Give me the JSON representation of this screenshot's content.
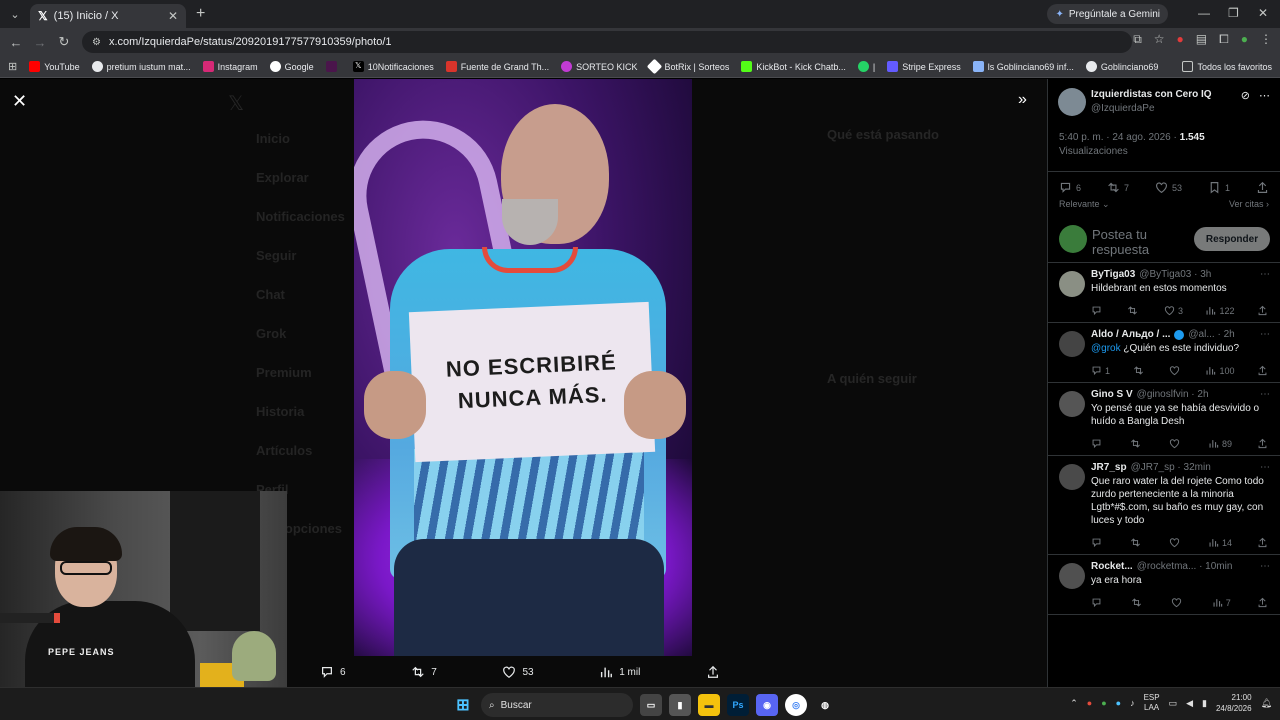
{
  "browser": {
    "tab_title": "(15) Inicio / X",
    "gemini_label": "Pregúntale a Gemini",
    "url": "x.com/IzquierdaPe/status/2092019177577910359/photo/1",
    "bookmarks": [
      "YouTube",
      "pretium iustum mat...",
      "Instagram",
      "Google",
      "10Notificaciones",
      "Fuente de Grand Th...",
      "SORTEO KICK",
      "BotRix | Sorteos",
      "KickBot - Kick Chatb...",
      "|",
      "Stripe Express",
      "ls Goblinciano69 inf...",
      "Goblinciano69"
    ],
    "bookmarks_all": "Todos los favoritos"
  },
  "background_nav": [
    "Inicio",
    "Explorar",
    "Notificaciones",
    "Seguir",
    "Chat",
    "Grok",
    "Premium",
    "Historia",
    "Artículos",
    "Perfil",
    "Más opciones"
  ],
  "background_right": {
    "trending": "Qué está pasando",
    "who_to_follow": "A quién seguir"
  },
  "photo": {
    "sign_text": "NO ESCRIBIRÉ NUNCA MÁS.",
    "actions": {
      "replies": "6",
      "reposts": "7",
      "likes": "53",
      "views": "1 mil"
    }
  },
  "webcam": {
    "hoodie_text": "PEPE JEANS"
  },
  "sidebar": {
    "author_name": "Izquierdistas con Cero IQ",
    "author_handle": "@IzquierdaPe",
    "post_time": "5:40 p. m. · 24 ago. 2026 ·",
    "views_count": "1.545",
    "views_label": "Visualizaciones",
    "stats": {
      "replies": "6",
      "reposts": "7",
      "likes": "53",
      "bookmarks": "1"
    },
    "sort_label": "Relevante",
    "quotes_label": "Ver citas",
    "reply_placeholder": "Postea tu respuesta",
    "reply_button": "Responder",
    "replies": [
      {
        "name": "ByTiga03",
        "handle": "@ByTiga03 · 3h",
        "text": "Hildebrant en estos momentos",
        "mention": "",
        "reply_count": "",
        "repost_count": "",
        "like_count": "3",
        "view_count": "122"
      },
      {
        "name": "Aldo / Альдо / ...",
        "handle": "@al... · 2h",
        "text": "¿Quién es este individuo?",
        "mention": "@grok",
        "reply_count": "1",
        "repost_count": "",
        "like_count": "",
        "view_count": "100"
      },
      {
        "name": "Gino S V",
        "handle": "@ginoslfvin · 2h",
        "text": "Yo pensé que ya se había desvivido o huído a Bangla Desh",
        "mention": "",
        "reply_count": "",
        "repost_count": "",
        "like_count": "",
        "view_count": "89"
      },
      {
        "name": "JR7_sp",
        "handle": "@JR7_sp · 32min",
        "text": "Que raro water la del rojete Como todo zurdo perteneciente a la minoria Lgtb*#$.com, su baño es muy gay, con luces y todo",
        "mention": "",
        "reply_count": "",
        "repost_count": "",
        "like_count": "",
        "view_count": "14"
      },
      {
        "name": "Rocket...",
        "handle": "@rocketma... · 10min",
        "text": "ya era hora",
        "mention": "",
        "reply_count": "",
        "repost_count": "",
        "like_count": "",
        "view_count": "7"
      }
    ]
  },
  "taskbar": {
    "search_label": "Buscar",
    "lang_top": "ESP",
    "lang_bottom": "LAA",
    "time": "21:00",
    "date": "24/8/2026"
  }
}
